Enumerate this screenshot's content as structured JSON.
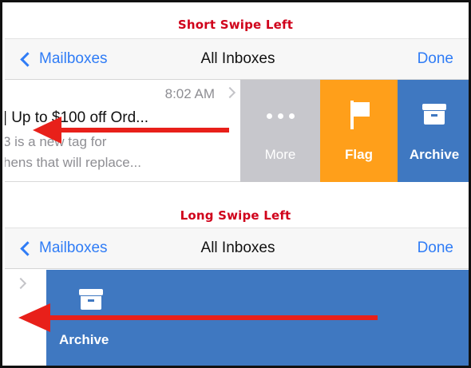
{
  "captions": {
    "short": "Short Swipe Left",
    "long": "Long Swipe Left"
  },
  "navbar": {
    "back_label": "Mailboxes",
    "title": "All Inboxes",
    "done_label": "Done"
  },
  "short_swipe_row": {
    "time": "8:02 AM",
    "subject": "| Up to $100 off Ord...",
    "preview_line1": "3 is a new tag for",
    "preview_line2": "hens that will replace...",
    "actions": {
      "more_label": "More",
      "flag_label": "Flag",
      "archive_label": "Archive"
    }
  },
  "long_swipe_row": {
    "archive_label": "Archive"
  },
  "colors": {
    "caption": "#d0021b",
    "ios_blue": "#2f7cf6",
    "more_bg": "#c7c7cc",
    "flag_bg": "#ff9f1a",
    "archive_bg": "#3f78c1",
    "arrow": "#e8201a"
  }
}
